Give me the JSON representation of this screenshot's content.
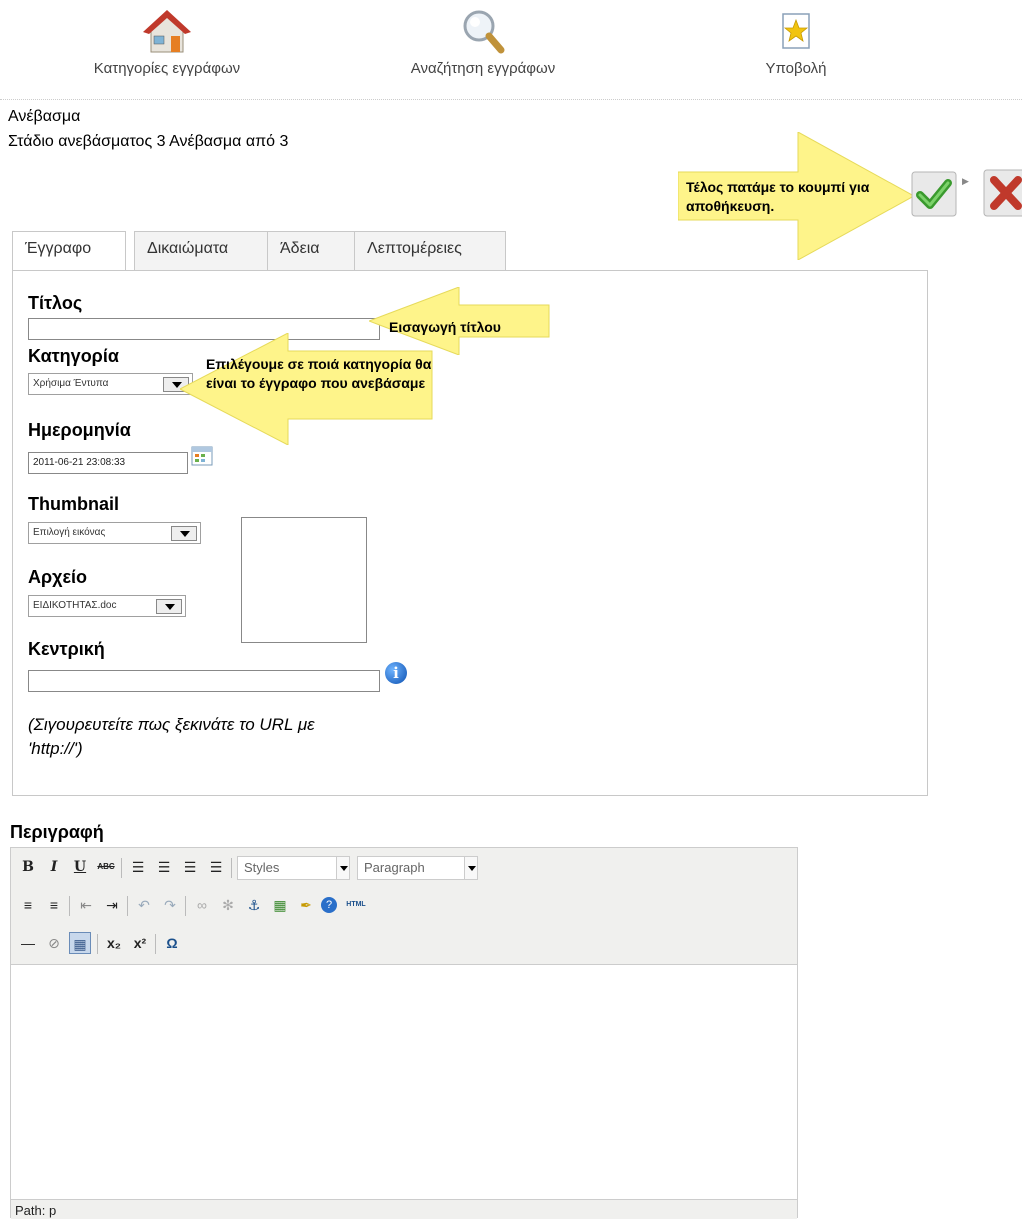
{
  "nav": {
    "items": [
      {
        "label": "Κατηγορίες εγγράφων",
        "icon": "home-icon"
      },
      {
        "label": "Αναζήτηση εγγράφων",
        "icon": "search-icon"
      },
      {
        "label": "Υποβολή",
        "icon": "star-document-icon"
      }
    ]
  },
  "page": {
    "title": "Ανέβασμα",
    "stage": "Στάδιο ανεβάσματος 3 Ανέβασμα από 3"
  },
  "actions": {
    "save_icon": "checkmark-icon",
    "cancel_icon": "cross-icon",
    "save_hint": "Τέλος πατάμε το κουμπί για αποθήκευση."
  },
  "tabs": [
    "Έγγραφο",
    "Δικαιώματα",
    "Άδεια",
    "Λεπτομέρειες"
  ],
  "form": {
    "title_label": "Τίτλος",
    "title_value": "",
    "category_label": "Κατηγορία",
    "category_value": "Χρήσιμα Έντυπα",
    "date_label": "Ημερομηνία",
    "date_value": "2011-06-21 23:08:33",
    "thumbnail_label": "Thumbnail",
    "thumbnail_value": "Επιλογή εικόνας",
    "file_label": "Αρχείο",
    "file_value": "ΕΙΔΙΚΟΤΗΤΑΣ.doc",
    "main_label": "Κεντρική",
    "main_value": "",
    "url_hint": "(Σιγουρευτείτε πως ξεκινάτε το URL με 'http://')"
  },
  "callouts": {
    "title": "Εισαγωγή τίτλου",
    "category": "Επιλέγουμε σε ποιά κατηγορία θα είναι το έγγραφο που ανεβάσαμε"
  },
  "editor": {
    "label": "Περιγραφή",
    "styles_placeholder": "Styles",
    "format_placeholder": "Paragraph",
    "path": "Path: p",
    "html_button": "HTML"
  }
}
